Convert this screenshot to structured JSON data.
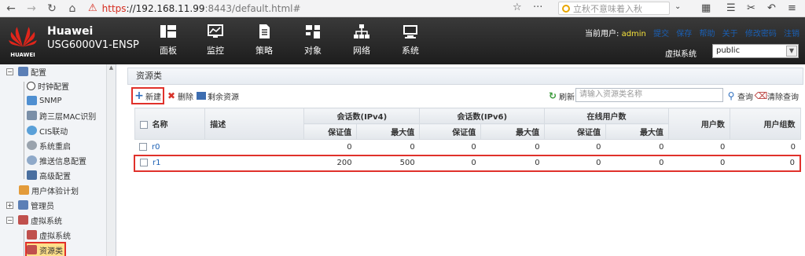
{
  "browser": {
    "url_scheme": "https",
    "url_host": "://192.168.11.99",
    "url_rest": ":8443/default.html#",
    "search_placeholder": "立秋不意味着入秋"
  },
  "header": {
    "logo_text": "HUAWEI",
    "brand": "Huawei",
    "model": "USG6000V1-ENSP",
    "menus": [
      {
        "label": "面板",
        "icon": "dashboard-icon"
      },
      {
        "label": "监控",
        "icon": "monitor-icon"
      },
      {
        "label": "策略",
        "icon": "policy-icon"
      },
      {
        "label": "对象",
        "icon": "object-icon"
      },
      {
        "label": "网络",
        "icon": "network-icon"
      },
      {
        "label": "系统",
        "icon": "system-icon"
      }
    ],
    "current_user_label": "当前用户:",
    "current_user": "admin",
    "links": [
      "提交",
      "保存",
      "帮助",
      "关于",
      "修改密码",
      "注销"
    ],
    "vsys_label": "虚拟系统",
    "vsys_value": "public",
    "colors": {
      "user": "#f6e23b",
      "header_bg": "#2a2a2a"
    }
  },
  "sidebar": {
    "items": [
      {
        "label": "配置",
        "level": 0,
        "expand": "-"
      },
      {
        "label": "时钟配置",
        "level": 1
      },
      {
        "label": "SNMP",
        "level": 1
      },
      {
        "label": "跨三层MAC识别",
        "level": 1
      },
      {
        "label": "CIS联动",
        "level": 1
      },
      {
        "label": "系统重启",
        "level": 1
      },
      {
        "label": "推送信息配置",
        "level": 1
      },
      {
        "label": "高级配置",
        "level": 1
      },
      {
        "label": "用户体验计划",
        "level": 0
      },
      {
        "label": "管理员",
        "level": 0,
        "expand": "+"
      },
      {
        "label": "虚拟系统",
        "level": 0,
        "expand": "-"
      },
      {
        "label": "虚拟系统",
        "level": 1
      },
      {
        "label": "资源类",
        "level": 1,
        "active": true
      }
    ]
  },
  "main": {
    "title": "资源类",
    "toolbar": {
      "new": "新建",
      "delete": "删除",
      "remaining": "剩余资源",
      "refresh": "刷新",
      "search_placeholder": "请输入资源类名称",
      "query": "查询",
      "clear": "清除查询"
    },
    "table": {
      "h_name": "名称",
      "h_desc": "描述",
      "h_sess4": "会话数(IPv4)",
      "h_sess6": "会话数(IPv6)",
      "h_online": "在线用户数",
      "h_users": "用户数",
      "h_groups": "用户组数",
      "h_guar": "保证值",
      "h_max": "最大值",
      "rows": [
        {
          "name": "r0",
          "desc": "",
          "v4g": "0",
          "v4m": "0",
          "v6g": "0",
          "v6m": "0",
          "og": "0",
          "om": "0",
          "users": "0",
          "groups": "0"
        },
        {
          "name": "r1",
          "desc": "",
          "v4g": "200",
          "v4m": "500",
          "v6g": "0",
          "v6m": "0",
          "og": "0",
          "om": "0",
          "users": "0",
          "groups": "0"
        }
      ]
    }
  }
}
